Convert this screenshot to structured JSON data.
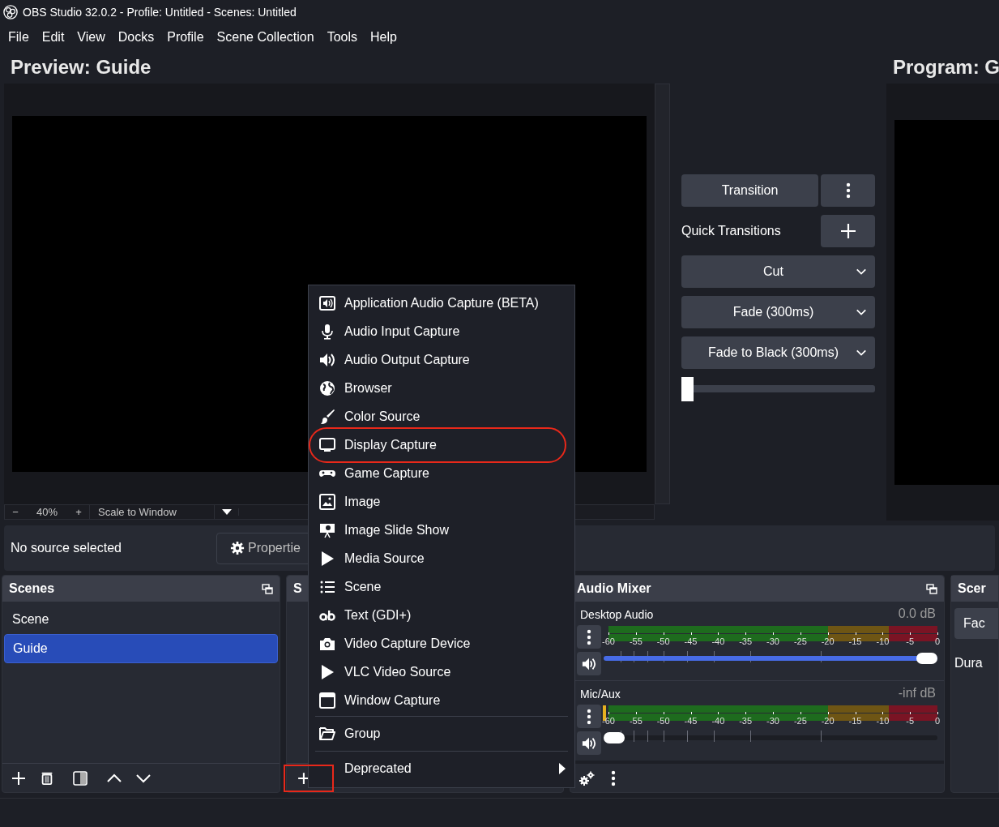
{
  "window": {
    "title": "OBS Studio 32.0.2 - Profile: Untitled - Scenes: Untitled"
  },
  "menu_bar": [
    "File",
    "Edit",
    "View",
    "Docks",
    "Profile",
    "Scene Collection",
    "Tools",
    "Help"
  ],
  "preview": {
    "title": "Preview: Guide",
    "zoom_out": "−",
    "zoom": "40%",
    "zoom_in": "+",
    "scale_mode": "Scale to Window"
  },
  "transitions": {
    "transition_button": "Transition",
    "quick_transitions_label": "Quick Transitions",
    "quick": [
      {
        "label": "Cut"
      },
      {
        "label": "Fade (300ms)"
      },
      {
        "label": "Fade to Black (300ms)"
      }
    ],
    "tbar": {
      "level": 0
    }
  },
  "program": {
    "title": "Program: G"
  },
  "source_toolbar": {
    "status": "No source selected",
    "properties_button": "Propertie"
  },
  "scenes_dock": {
    "title": "Scenes",
    "items": [
      {
        "label": "Scene",
        "selected": false
      },
      {
        "label": "Guide",
        "selected": true
      }
    ]
  },
  "sources_dock": {
    "title": "S",
    "add_button": "+",
    "add_button_annotated": true
  },
  "audio_mixer": {
    "title": "Audio Mixer",
    "channels": [
      {
        "name": "Desktop Audio",
        "reading": "0.0 dB",
        "peak": false,
        "level": 1,
        "scale": [
          "-60",
          "-55",
          "-50",
          "-45",
          "-40",
          "-35",
          "-30",
          "-25",
          "-20",
          "-15",
          "-10",
          "-5",
          "0"
        ]
      },
      {
        "name": "Mic/Aux",
        "reading": "-inf dB",
        "peak": true,
        "level": 0,
        "scale": [
          "-60",
          "-55",
          "-50",
          "-45",
          "-40",
          "-35",
          "-30",
          "-25",
          "-20",
          "-15",
          "-10",
          "-5",
          "0"
        ]
      }
    ]
  },
  "scene_transitions_dock": {
    "title": "Scer",
    "transition": "Fac",
    "duration_label": "Dura"
  },
  "add_source_menu": {
    "sections": [
      [
        {
          "label": "Application Audio Capture (BETA)",
          "circled": false
        },
        {
          "label": "Audio Input Capture",
          "circled": false
        },
        {
          "label": "Audio Output Capture",
          "circled": false
        },
        {
          "label": "Browser",
          "circled": false
        },
        {
          "label": "Color Source",
          "circled": false
        },
        {
          "label": "Display Capture",
          "circled": true
        },
        {
          "label": "Game Capture",
          "circled": false
        },
        {
          "label": "Image",
          "circled": false
        },
        {
          "label": "Image Slide Show",
          "circled": false
        },
        {
          "label": "Media Source",
          "circled": false
        },
        {
          "label": "Scene",
          "circled": false
        },
        {
          "label": "Text (GDI+)",
          "circled": false
        },
        {
          "label": "Video Capture Device",
          "circled": false
        },
        {
          "label": "VLC Video Source",
          "circled": false
        },
        {
          "label": "Window Capture",
          "circled": false
        }
      ],
      [
        {
          "label": "Group",
          "circled": false
        }
      ],
      [
        {
          "label": "Deprecated",
          "circled": false,
          "submenu": true
        }
      ]
    ]
  }
}
